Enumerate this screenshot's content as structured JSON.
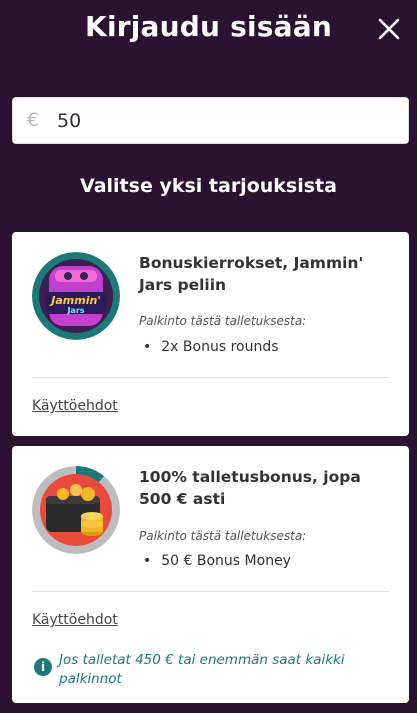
{
  "header": {
    "title": "Kirjaudu sisään",
    "close_icon": "close-icon"
  },
  "amount": {
    "currency": "€",
    "value": "50"
  },
  "section_title": "Valitse yksi tarjouksista",
  "offers": [
    {
      "title": "Bonuskierrokset, Jammin' Jars peliin",
      "prize_label": "Palkinto tästä talletuksesta:",
      "prize_item": "2x Bonus rounds",
      "terms": "Käyttöehdot",
      "thumb_text": "Jammin' Jars",
      "colors": {
        "ring": "#1b7a77"
      }
    },
    {
      "title": "100% talletusbonus, jopa 500 € asti",
      "prize_label": "Palkinto tästä talletuksesta:",
      "prize_item": "50 € Bonus Money",
      "terms": "Käyttöehdot",
      "info_icon": "info-icon",
      "info_text": "Jos talletat 450 € tai enemmän saat kaikki palkinnot",
      "progress_fraction": 0.11,
      "colors": {
        "ring": "#bdbdbd",
        "progress": "#1b7a77",
        "bg": "#e84a3c"
      }
    }
  ],
  "colors": {
    "background": "#2b1233",
    "accent": "#1e7a78"
  }
}
